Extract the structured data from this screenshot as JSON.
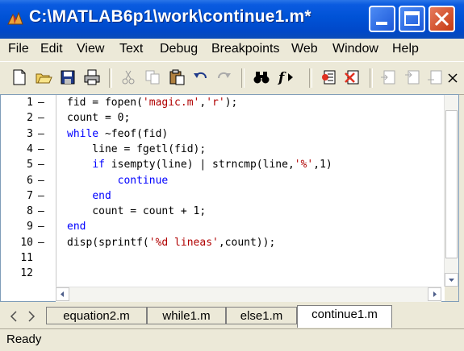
{
  "window": {
    "title": "C:\\MATLAB6p1\\work\\continue1.m*"
  },
  "menu": [
    {
      "label": "File"
    },
    {
      "label": "Edit"
    },
    {
      "label": "View"
    },
    {
      "label": "Text"
    },
    {
      "label": "Debug"
    },
    {
      "label": "Breakpoints"
    },
    {
      "label": "Web"
    },
    {
      "label": "Window"
    },
    {
      "label": "Help"
    }
  ],
  "editor": {
    "line_numbers": [
      "1",
      "2",
      "3",
      "4",
      "5",
      "6",
      "7",
      "8",
      "9",
      "10",
      "11",
      "12"
    ],
    "breakpoint_marks": [
      "–",
      "–",
      "–",
      "–",
      "–",
      "–",
      "–",
      "–",
      "–",
      "–",
      "",
      ""
    ],
    "lines": [
      [
        {
          "t": "fid = fopen(",
          "c": "plain"
        },
        {
          "t": "'magic.m'",
          "c": "strred"
        },
        {
          "t": ",",
          "c": "plain"
        },
        {
          "t": "'r'",
          "c": "strred"
        },
        {
          "t": ");",
          "c": "plain"
        }
      ],
      [
        {
          "t": "count = 0;",
          "c": "plain"
        }
      ],
      [
        {
          "t": "while",
          "c": "kw"
        },
        {
          "t": " ~feof(fid)",
          "c": "plain"
        }
      ],
      [
        {
          "t": "    line = fgetl(fid);",
          "c": "plain"
        }
      ],
      [
        {
          "t": "    ",
          "c": "plain"
        },
        {
          "t": "if",
          "c": "kw"
        },
        {
          "t": " isempty(line) | strncmp(line,",
          "c": "plain"
        },
        {
          "t": "'%'",
          "c": "strred"
        },
        {
          "t": ",1)",
          "c": "plain"
        }
      ],
      [
        {
          "t": "        ",
          "c": "plain"
        },
        {
          "t": "continue",
          "c": "kw"
        }
      ],
      [
        {
          "t": "    ",
          "c": "plain"
        },
        {
          "t": "end",
          "c": "kw"
        }
      ],
      [
        {
          "t": "    count = count + 1;",
          "c": "plain"
        }
      ],
      [
        {
          "t": "end",
          "c": "kw"
        }
      ],
      [
        {
          "t": "disp(sprintf(",
          "c": "plain"
        },
        {
          "t": "'%d lineas'",
          "c": "strred"
        },
        {
          "t": ",count));",
          "c": "plain"
        }
      ],
      [],
      []
    ]
  },
  "tabs": [
    {
      "label": "equation2.m",
      "active": false
    },
    {
      "label": "while1.m",
      "active": false
    },
    {
      "label": "else1.m",
      "active": false
    },
    {
      "label": "continue1.m",
      "active": true
    }
  ],
  "status": {
    "text": "Ready"
  },
  "colors": {
    "keyword": "#0000ff",
    "string": "#b00000",
    "titlebar": "#0052d6"
  }
}
